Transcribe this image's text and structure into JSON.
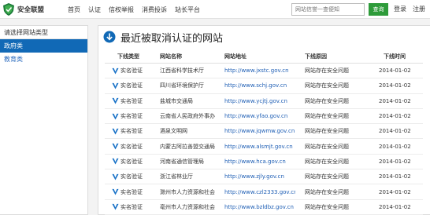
{
  "header": {
    "logo_text": "安全联盟",
    "nav": [
      "首页",
      "认证",
      "信权举报",
      "消费投诉",
      "站长平台"
    ],
    "search_placeholder": "网站信誉一查便知",
    "search_button": "查询",
    "login": "登录",
    "register": "注册"
  },
  "sidebar": {
    "heading": "请选择网站类型",
    "items": [
      {
        "label": "政府类",
        "active": true
      },
      {
        "label": "教育类",
        "active": false
      }
    ]
  },
  "main": {
    "title": "最近被取消认证的网站",
    "columns": [
      "下线类型",
      "网站名称",
      "网站地址",
      "下线原因",
      "下线时间"
    ],
    "rows": [
      {
        "type": "实名验证",
        "name": "江西省科学技术厅",
        "url": "http://www.jxstc.gov.cn",
        "reason": "网站存在安全问题",
        "date": "2014-01-02"
      },
      {
        "type": "实名验证",
        "name": "四川省环境保护厅",
        "url": "http://www.schj.gov.cn",
        "reason": "网站存在安全问题",
        "date": "2014-01-02"
      },
      {
        "type": "实名验证",
        "name": "盐城市交通局",
        "url": "http://www.ycjtj.gov.cn",
        "reason": "网站存在安全问题",
        "date": "2014-01-02"
      },
      {
        "type": "实名验证",
        "name": "云南省人民政府外事办公室",
        "url": "http://www.yfao.gov.cn",
        "reason": "网站存在安全问题",
        "date": "2014-01-02"
      },
      {
        "type": "实名验证",
        "name": "酒泉文明网",
        "url": "http://www.jqwmw.gov.cn",
        "reason": "网站存在安全问题",
        "date": "2014-01-02"
      },
      {
        "type": "实名验证",
        "name": "内蒙古阿拉善盟交通局",
        "url": "http://www.alsmjt.gov.cn",
        "reason": "网站存在安全问题",
        "date": "2014-01-02"
      },
      {
        "type": "实名验证",
        "name": "河南省通信管理局",
        "url": "http://www.hca.gov.cn",
        "reason": "网站存在安全问题",
        "date": "2014-01-02"
      },
      {
        "type": "实名验证",
        "name": "浙江省林业厅",
        "url": "http://www.zjly.gov.cn",
        "reason": "网站存在安全问题",
        "date": "2014-01-02"
      },
      {
        "type": "实名验证",
        "name": "滁州市人力资源和社会保...",
        "url": "http://www.czl2333.gov.cn",
        "reason": "网站存在安全问题",
        "date": "2014-01-02"
      },
      {
        "type": "实名验证",
        "name": "亳州市人力资源和社会保...",
        "url": "http://www.bzldbz.gov.cn",
        "reason": "网站存在安全问题",
        "date": "2014-01-02"
      }
    ]
  },
  "colors": {
    "accent_blue": "#1169b6",
    "search_green": "#2e9b3a",
    "link_blue": "#1f5fb5"
  },
  "icons": {
    "logo": "shield-logo-icon",
    "title": "download-arrow-circle-icon",
    "badge": "check-v-icon"
  }
}
